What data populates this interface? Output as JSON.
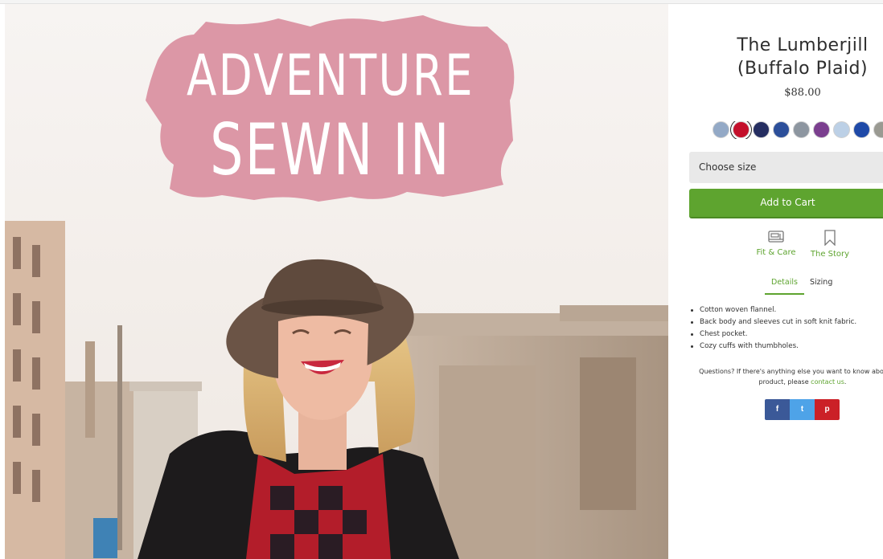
{
  "hero": {
    "banner_line1": "ADVENTURE",
    "banner_line2": "SEWN IN"
  },
  "product": {
    "title_line1": "The Lumberjill",
    "title_line2": "(Buffalo Plaid)",
    "price": "$88.00"
  },
  "swatches": [
    "#93a9c6",
    "#c4102b",
    "#252e61",
    "#2c4f9a",
    "#8d96a0",
    "#7b3f8f",
    "#bcd0e6",
    "#1f4aa8",
    "#9a9a92"
  ],
  "size_select": {
    "placeholder": "Choose size"
  },
  "add_to_cart": {
    "label": "Add to Cart"
  },
  "links": {
    "fit_care": {
      "label": "Fit & Care",
      "icon": "sewing-machine-icon"
    },
    "story": {
      "label": "The Story",
      "icon": "bookmark-icon"
    }
  },
  "tabs": {
    "details": "Details",
    "sizing": "Sizing"
  },
  "details_list": [
    "Cotton woven flannel.",
    "Back body and sleeves cut in soft knit fabric.",
    "Chest pocket.",
    "Cozy cuffs with thumbholes."
  ],
  "questions": {
    "line1": "Questions? If there's anything else you want to know abo",
    "line2_prefix": "product, please ",
    "contact_link": "contact us",
    "line2_suffix": "."
  },
  "share": {
    "facebook": "f",
    "twitter": "t",
    "pinterest": "p"
  },
  "colors": {
    "accent_green": "#5ea42f",
    "banner_pink": "#dc97a6",
    "facebook": "#3b5998",
    "twitter": "#4ea3e8",
    "pinterest": "#cb2027"
  }
}
